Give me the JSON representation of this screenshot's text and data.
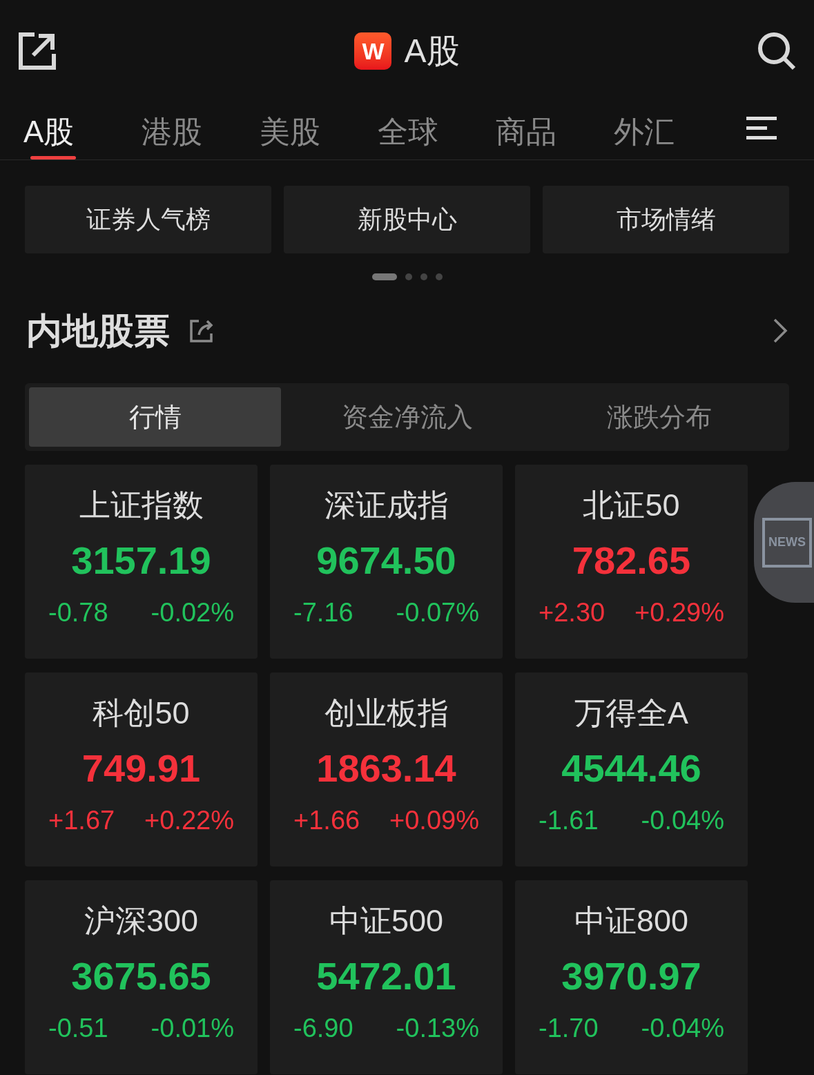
{
  "header": {
    "logo": "W",
    "title": "A股"
  },
  "tabs": [
    {
      "label": "A股",
      "selected": true
    },
    {
      "label": "港股",
      "selected": false
    },
    {
      "label": "美股",
      "selected": false
    },
    {
      "label": "全球",
      "selected": false
    },
    {
      "label": "商品",
      "selected": false
    },
    {
      "label": "外汇",
      "selected": false
    }
  ],
  "shortcuts": [
    "证券人气榜",
    "新股中心",
    "市场情绪"
  ],
  "page_dots": [
    {
      "selected": true
    },
    {
      "selected": false
    },
    {
      "selected": false
    },
    {
      "selected": false
    }
  ],
  "section": {
    "title": "内地股票"
  },
  "segments": [
    {
      "label": "行情",
      "selected": true
    },
    {
      "label": "资金净流入",
      "selected": false
    },
    {
      "label": "涨跌分布",
      "selected": false
    }
  ],
  "indices": [
    {
      "name": "上证指数",
      "value": "3157.19",
      "change": "-0.78",
      "percent": "-0.02%",
      "color": "#21c25c"
    },
    {
      "name": "深证成指",
      "value": "9674.50",
      "change": "-7.16",
      "percent": "-0.07%",
      "color": "#21c25c"
    },
    {
      "name": "北证50",
      "value": "782.65",
      "change": "+2.30",
      "percent": "+0.29%",
      "color": "#f5313b"
    },
    {
      "name": "科创50",
      "value": "749.91",
      "change": "+1.67",
      "percent": "+0.22%",
      "color": "#f5313b"
    },
    {
      "name": "创业板指",
      "value": "1863.14",
      "change": "+1.66",
      "percent": "+0.09%",
      "color": "#f5313b"
    },
    {
      "name": "万得全A",
      "value": "4544.46",
      "change": "-1.61",
      "percent": "-0.04%",
      "color": "#21c25c"
    },
    {
      "name": "沪深300",
      "value": "3675.65",
      "change": "-0.51",
      "percent": "-0.01%",
      "color": "#21c25c"
    },
    {
      "name": "中证500",
      "value": "5472.01",
      "change": "-6.90",
      "percent": "-0.13%",
      "color": "#21c25c"
    },
    {
      "name": "中证800",
      "value": "3970.97",
      "change": "-1.70",
      "percent": "-0.04%",
      "color": "#21c25c"
    }
  ],
  "news_button": {
    "label": "NEWS"
  }
}
